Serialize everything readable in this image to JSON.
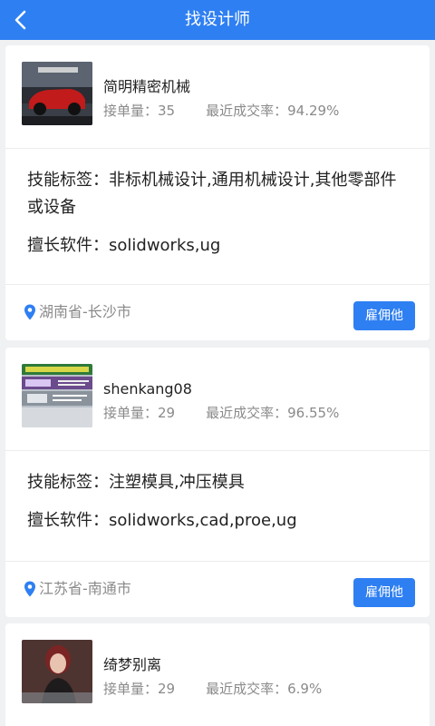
{
  "header": {
    "title": "找设计师"
  },
  "designers": [
    {
      "name": "简明精密机械",
      "orders_label": "接单量：",
      "orders": "35",
      "rate_label": "最近成交率：",
      "rate": "94.29%",
      "skills_label": "技能标签：",
      "skills": "非标机械设计,通用机械设计,其他零部件或设备",
      "software_label": "擅长软件：",
      "software": "solidworks,ug",
      "location": "湖南省-长沙市",
      "hire_label": "雇佣他"
    },
    {
      "name": "shenkang08",
      "orders_label": "接单量：",
      "orders": "29",
      "rate_label": "最近成交率：",
      "rate": "96.55%",
      "skills_label": "技能标签：",
      "skills": "注塑模具,冲压模具",
      "software_label": "擅长软件：",
      "software": "solidworks,cad,proe,ug",
      "location": "江苏省-南通市",
      "hire_label": "雇佣他"
    },
    {
      "name": "绮梦别离",
      "orders_label": "接单量：",
      "orders": "29",
      "rate_label": "最近成交率：",
      "rate": "6.9%"
    }
  ],
  "colors": {
    "accent": "#2e7ff2",
    "muted_text": "#8a8a8a",
    "background": "#f0f1f3"
  },
  "icons": {
    "back": "chevron-left-icon",
    "location": "map-pin-icon"
  }
}
